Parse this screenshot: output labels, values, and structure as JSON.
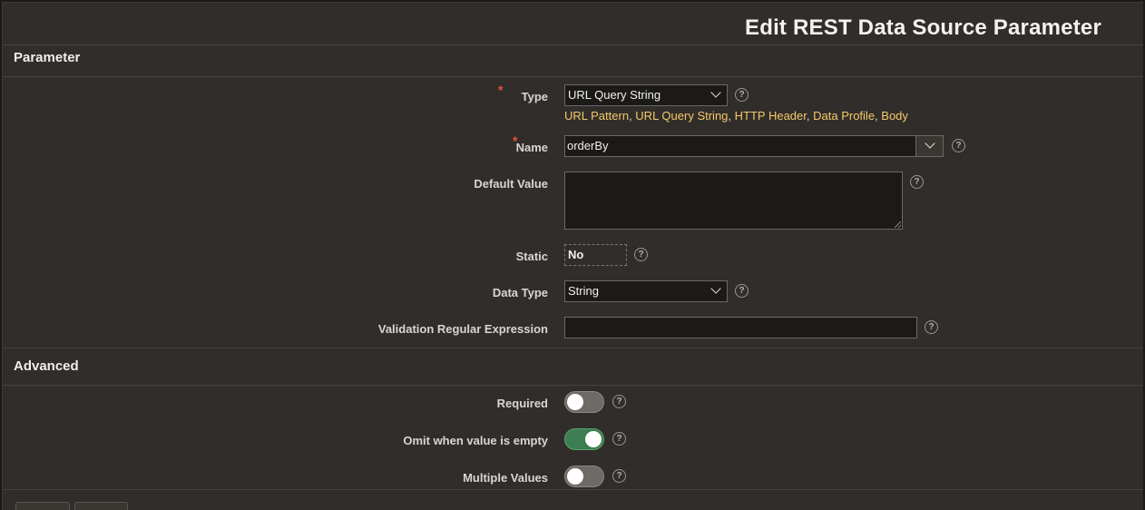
{
  "dialog": {
    "title": "Edit REST Data Source Parameter"
  },
  "sections": {
    "parameter": "Parameter",
    "advanced": "Advanced"
  },
  "fields": {
    "type": {
      "label": "Type",
      "value": "URL Query String",
      "hint_options": [
        "URL Pattern",
        "URL Query String",
        "HTTP Header",
        "Data Profile",
        "Body"
      ]
    },
    "name": {
      "label": "Name",
      "value": "orderBy"
    },
    "default_value": {
      "label": "Default Value",
      "value": ""
    },
    "static": {
      "label": "Static",
      "value": "No"
    },
    "data_type": {
      "label": "Data Type",
      "value": "String"
    },
    "validation_regex": {
      "label": "Validation Regular Expression",
      "value": ""
    }
  },
  "advanced": {
    "required": {
      "label": "Required",
      "on": false
    },
    "omit_when_empty": {
      "label": "Omit when value is empty",
      "on": true
    },
    "multiple_values": {
      "label": "Multiple Values",
      "on": false
    }
  },
  "icons": {
    "help": "?",
    "required_marker": "*"
  },
  "colors": {
    "accent_hint": "#f4c96b",
    "toggle_on": "#3c7d51",
    "required": "#e5533d"
  }
}
